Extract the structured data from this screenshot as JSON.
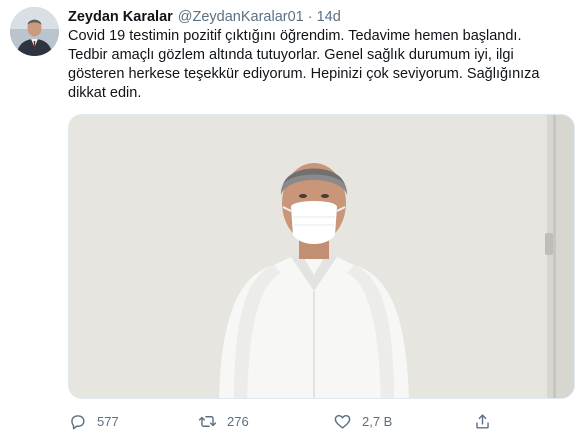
{
  "tweet": {
    "author_name": "Zeydan Karalar",
    "author_handle": "@ZeydanKaralar01",
    "separator": "·",
    "time": "14d",
    "text": "Covid 19 testimin pozitif çıktığını öğrendim. Tedavime hemen başlandı.\nTedbir amaçlı gözlem altında tutuyorlar. Genel sağlık durumum iyi, ilgi\ngösteren herkese teşekkür ediyorum. Hepinizi çok seviyorum. Sağlığınıza\ndikkat edin.",
    "actions": {
      "reply_count": "577",
      "retweet_count": "276",
      "like_count": "2,7 B"
    }
  },
  "icons": {
    "reply": "reply-icon",
    "retweet": "retweet-icon",
    "like": "heart-icon",
    "share": "share-icon"
  },
  "colors": {
    "text": "#0f1419",
    "secondary": "#5b7083",
    "media_bg": "#e9e8e3"
  }
}
